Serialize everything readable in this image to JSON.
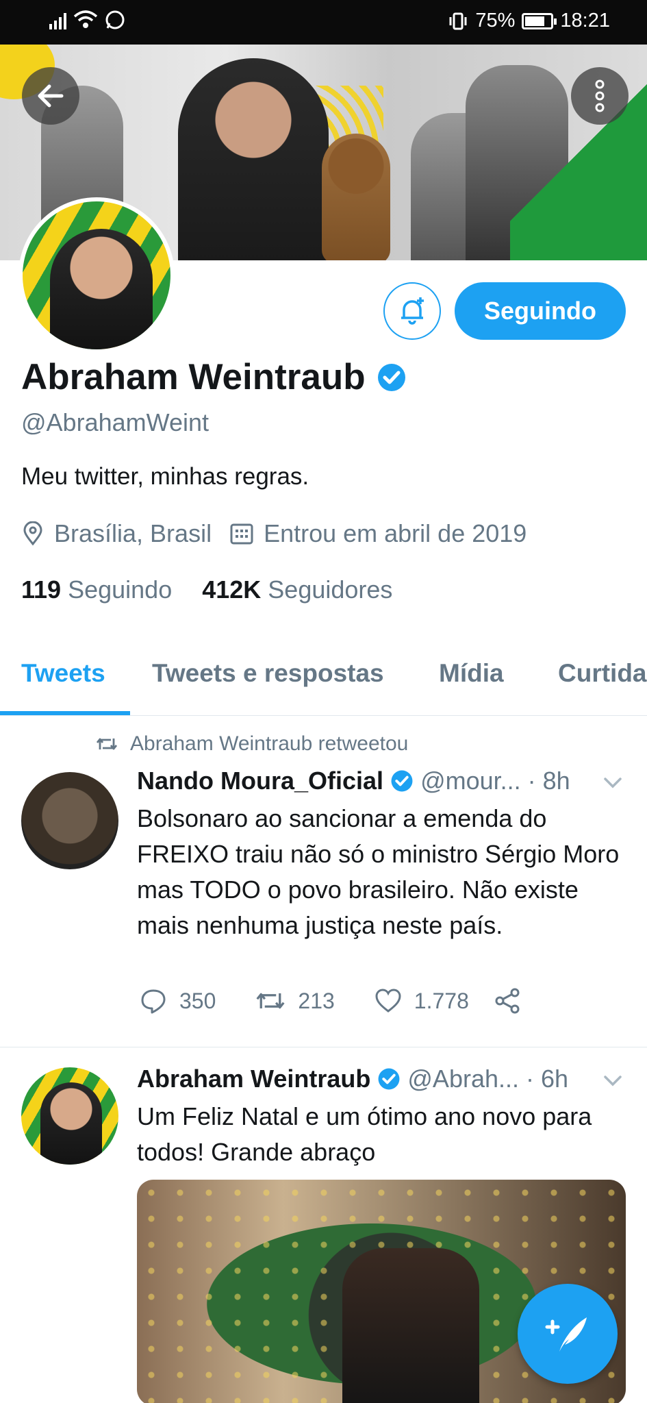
{
  "status_bar": {
    "battery": "75%",
    "time": "18:21"
  },
  "header": {
    "back_icon": "arrow-left-icon",
    "more_icon": "more-vertical-icon"
  },
  "profile": {
    "name": "Abraham Weintraub",
    "handle": "@AbrahamWeint",
    "bio": "Meu twitter, minhas regras.",
    "location": "Brasília, Brasil",
    "joined": "Entrou em abril de 2019",
    "following_count": "119",
    "following_label": "Seguindo",
    "followers_count": "412K",
    "followers_label": "Seguidores",
    "follow_button": "Seguindo",
    "accent": "#1da1f2"
  },
  "tabs": [
    {
      "label": "Tweets",
      "active": true
    },
    {
      "label": "Tweets e respostas",
      "active": false
    },
    {
      "label": "Mídia",
      "active": false
    },
    {
      "label": "Curtida",
      "active": false
    }
  ],
  "tweets": [
    {
      "retweet_label": "Abraham Weintraub retweetou",
      "name": "Nando Moura_Oficial",
      "handle": "@mour...",
      "time": "· 8h",
      "text": "Bolsonaro ao sancionar a emenda do FREIXO traiu não só o ministro Sérgio Moro mas TODO o povo brasileiro. Não existe mais nenhuma justiça neste país.",
      "replies": "350",
      "retweets": "213",
      "likes": "1.778"
    },
    {
      "name": "Abraham Weintraub",
      "handle": "@Abrah...",
      "time": "· 6h",
      "text": "Um Feliz Natal e um ótimo ano novo para todos! Grande abraço"
    }
  ]
}
